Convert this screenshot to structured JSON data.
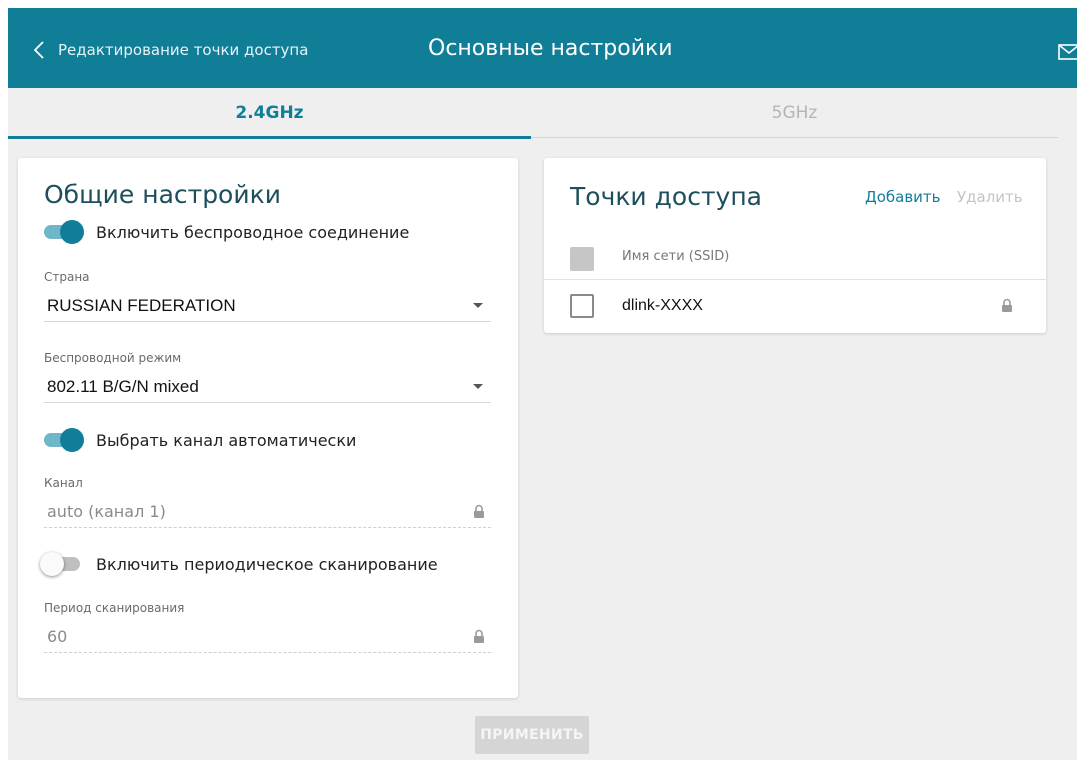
{
  "header": {
    "back_label": "Редактирование точки доступа",
    "title": "Основные настройки",
    "accent_color": "#117e98"
  },
  "tabs": [
    {
      "label": "2.4GHz",
      "active": true
    },
    {
      "label": "5GHz",
      "active": false
    }
  ],
  "general": {
    "title": "Общие настройки",
    "enable_wireless": {
      "label": "Включить беспроводное соединение",
      "on": true
    },
    "country": {
      "label": "Страна",
      "value": "RUSSIAN FEDERATION"
    },
    "wireless_mode": {
      "label": "Беспроводной режим",
      "value": "802.11 B/G/N mixed"
    },
    "auto_channel": {
      "label": "Выбрать канал автоматически",
      "on": true
    },
    "channel": {
      "label": "Канал",
      "value": "auto (канал 1)",
      "locked": true
    },
    "periodic_scan": {
      "label": "Включить периодическое сканирование",
      "on": false
    },
    "scan_period": {
      "label": "Период сканирования",
      "value": "60",
      "locked": true
    }
  },
  "access_points": {
    "title": "Точки доступа",
    "add_label": "Добавить",
    "delete_label": "Удалить",
    "column_ssid": "Имя сети (SSID)",
    "rows": [
      {
        "ssid": "dlink-XXXX",
        "secured": true,
        "checked": false
      }
    ]
  },
  "apply_label": "ПРИМЕНИТЬ",
  "icons": [
    "chevron-left-icon",
    "mail-icon",
    "lock-icon",
    "dropdown-caret-icon"
  ]
}
